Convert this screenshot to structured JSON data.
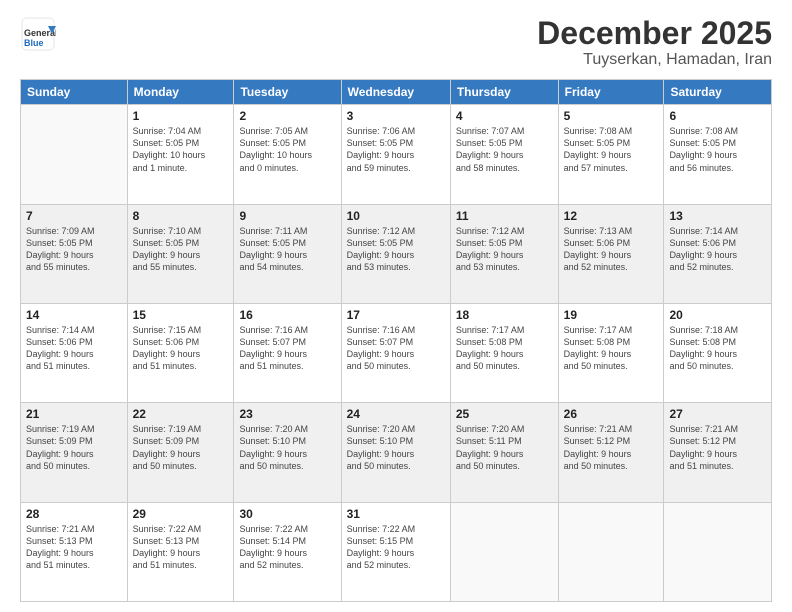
{
  "logo": {
    "general": "General",
    "blue": "Blue",
    "tagline": ""
  },
  "header": {
    "month": "December 2025",
    "location": "Tuyserkan, Hamadan, Iran"
  },
  "days_of_week": [
    "Sunday",
    "Monday",
    "Tuesday",
    "Wednesday",
    "Thursday",
    "Friday",
    "Saturday"
  ],
  "weeks": [
    [
      {
        "day": "",
        "info": ""
      },
      {
        "day": "1",
        "info": "Sunrise: 7:04 AM\nSunset: 5:05 PM\nDaylight: 10 hours\nand 1 minute."
      },
      {
        "day": "2",
        "info": "Sunrise: 7:05 AM\nSunset: 5:05 PM\nDaylight: 10 hours\nand 0 minutes."
      },
      {
        "day": "3",
        "info": "Sunrise: 7:06 AM\nSunset: 5:05 PM\nDaylight: 9 hours\nand 59 minutes."
      },
      {
        "day": "4",
        "info": "Sunrise: 7:07 AM\nSunset: 5:05 PM\nDaylight: 9 hours\nand 58 minutes."
      },
      {
        "day": "5",
        "info": "Sunrise: 7:08 AM\nSunset: 5:05 PM\nDaylight: 9 hours\nand 57 minutes."
      },
      {
        "day": "6",
        "info": "Sunrise: 7:08 AM\nSunset: 5:05 PM\nDaylight: 9 hours\nand 56 minutes."
      }
    ],
    [
      {
        "day": "7",
        "info": "Sunrise: 7:09 AM\nSunset: 5:05 PM\nDaylight: 9 hours\nand 55 minutes."
      },
      {
        "day": "8",
        "info": "Sunrise: 7:10 AM\nSunset: 5:05 PM\nDaylight: 9 hours\nand 55 minutes."
      },
      {
        "day": "9",
        "info": "Sunrise: 7:11 AM\nSunset: 5:05 PM\nDaylight: 9 hours\nand 54 minutes."
      },
      {
        "day": "10",
        "info": "Sunrise: 7:12 AM\nSunset: 5:05 PM\nDaylight: 9 hours\nand 53 minutes."
      },
      {
        "day": "11",
        "info": "Sunrise: 7:12 AM\nSunset: 5:05 PM\nDaylight: 9 hours\nand 53 minutes."
      },
      {
        "day": "12",
        "info": "Sunrise: 7:13 AM\nSunset: 5:06 PM\nDaylight: 9 hours\nand 52 minutes."
      },
      {
        "day": "13",
        "info": "Sunrise: 7:14 AM\nSunset: 5:06 PM\nDaylight: 9 hours\nand 52 minutes."
      }
    ],
    [
      {
        "day": "14",
        "info": "Sunrise: 7:14 AM\nSunset: 5:06 PM\nDaylight: 9 hours\nand 51 minutes."
      },
      {
        "day": "15",
        "info": "Sunrise: 7:15 AM\nSunset: 5:06 PM\nDaylight: 9 hours\nand 51 minutes."
      },
      {
        "day": "16",
        "info": "Sunrise: 7:16 AM\nSunset: 5:07 PM\nDaylight: 9 hours\nand 51 minutes."
      },
      {
        "day": "17",
        "info": "Sunrise: 7:16 AM\nSunset: 5:07 PM\nDaylight: 9 hours\nand 50 minutes."
      },
      {
        "day": "18",
        "info": "Sunrise: 7:17 AM\nSunset: 5:08 PM\nDaylight: 9 hours\nand 50 minutes."
      },
      {
        "day": "19",
        "info": "Sunrise: 7:17 AM\nSunset: 5:08 PM\nDaylight: 9 hours\nand 50 minutes."
      },
      {
        "day": "20",
        "info": "Sunrise: 7:18 AM\nSunset: 5:08 PM\nDaylight: 9 hours\nand 50 minutes."
      }
    ],
    [
      {
        "day": "21",
        "info": "Sunrise: 7:19 AM\nSunset: 5:09 PM\nDaylight: 9 hours\nand 50 minutes."
      },
      {
        "day": "22",
        "info": "Sunrise: 7:19 AM\nSunset: 5:09 PM\nDaylight: 9 hours\nand 50 minutes."
      },
      {
        "day": "23",
        "info": "Sunrise: 7:20 AM\nSunset: 5:10 PM\nDaylight: 9 hours\nand 50 minutes."
      },
      {
        "day": "24",
        "info": "Sunrise: 7:20 AM\nSunset: 5:10 PM\nDaylight: 9 hours\nand 50 minutes."
      },
      {
        "day": "25",
        "info": "Sunrise: 7:20 AM\nSunset: 5:11 PM\nDaylight: 9 hours\nand 50 minutes."
      },
      {
        "day": "26",
        "info": "Sunrise: 7:21 AM\nSunset: 5:12 PM\nDaylight: 9 hours\nand 50 minutes."
      },
      {
        "day": "27",
        "info": "Sunrise: 7:21 AM\nSunset: 5:12 PM\nDaylight: 9 hours\nand 51 minutes."
      }
    ],
    [
      {
        "day": "28",
        "info": "Sunrise: 7:21 AM\nSunset: 5:13 PM\nDaylight: 9 hours\nand 51 minutes."
      },
      {
        "day": "29",
        "info": "Sunrise: 7:22 AM\nSunset: 5:13 PM\nDaylight: 9 hours\nand 51 minutes."
      },
      {
        "day": "30",
        "info": "Sunrise: 7:22 AM\nSunset: 5:14 PM\nDaylight: 9 hours\nand 52 minutes."
      },
      {
        "day": "31",
        "info": "Sunrise: 7:22 AM\nSunset: 5:15 PM\nDaylight: 9 hours\nand 52 minutes."
      },
      {
        "day": "",
        "info": ""
      },
      {
        "day": "",
        "info": ""
      },
      {
        "day": "",
        "info": ""
      }
    ]
  ]
}
